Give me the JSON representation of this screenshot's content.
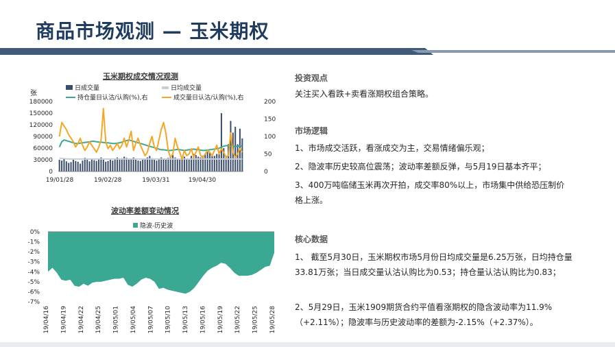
{
  "page": {
    "title": "商品市场观测 — 玉米期权"
  },
  "chart1": {
    "title": "玉米期权成交情况观测",
    "unit": "张",
    "legend": [
      "日成交量",
      "日均成交量",
      "持仓量日认沽/认购(%),右",
      "成交量日认沽/认购(%),右"
    ],
    "left_ticks": [
      "180000",
      "150000",
      "120000",
      "90000",
      "60000",
      "30000",
      "0"
    ],
    "right_ticks": [
      "200",
      "150",
      "100",
      "50",
      "0"
    ],
    "x_ticks": [
      "19/01/28",
      "19/02/28",
      "19/03/31",
      "19/04/30"
    ]
  },
  "chart2": {
    "title": "波动率差额变动情况",
    "legend": [
      "隐波-历史波"
    ],
    "y_ticks": [
      "0%",
      "-1%",
      "-2%",
      "-3%",
      "-4%",
      "-5%",
      "-6%",
      "-7%"
    ],
    "x_ticks": [
      "19/04/16",
      "19/04/19",
      "19/04/22",
      "19/04/25",
      "19/05/01",
      "19/05/04",
      "19/05/07",
      "19/05/10",
      "19/05/13",
      "19/05/16",
      "19/05/19",
      "19/05/22",
      "19/05/25",
      "19/05/28"
    ]
  },
  "chart_data": [
    {
      "type": "bar",
      "title": "玉米期权成交情况观测",
      "ylabel": "张",
      "ylim": [
        0,
        180000
      ],
      "y2lim": [
        0,
        200
      ],
      "x_range": [
        "19/01/28",
        "19/05/30"
      ],
      "series": [
        {
          "name": "日成交量",
          "axis": "left",
          "kind": "bar",
          "values": [
            30000,
            28000,
            32000,
            26000,
            22000,
            24000,
            30000,
            27000,
            25000,
            20000,
            28000,
            35000,
            30000,
            26000,
            31000,
            29000,
            27000,
            33000,
            36000,
            30000,
            25000,
            27000,
            30000,
            28000,
            32000,
            36000,
            30000,
            34000,
            38000,
            35000,
            30000,
            32000,
            36000,
            30000,
            28000,
            27000,
            30000,
            33000,
            36000,
            40000,
            34000,
            30000,
            28000,
            32000,
            36000,
            33000,
            30000,
            35000,
            38000,
            42000,
            36000,
            32000,
            30000,
            35000,
            38000,
            33000,
            30000,
            40000,
            45000,
            42000,
            38000,
            36000,
            40000,
            45000,
            50000,
            48000,
            42000,
            40000,
            45000,
            52000,
            150000,
            60000,
            40000,
            70000,
            130000,
            100000,
            115000,
            70000,
            110000,
            85000
          ]
        },
        {
          "name": "日均成交量",
          "axis": "left",
          "kind": "line",
          "values": [
            34000,
            33500,
            33000,
            32500,
            32000,
            32000,
            32000,
            32000,
            32000,
            32000,
            32000,
            32000,
            32000,
            32000,
            32000,
            32000,
            32000,
            32000,
            32000,
            32000,
            32000,
            32000,
            32000,
            32000,
            32000,
            32000,
            32000,
            32000,
            32000,
            32000,
            32000,
            32000,
            32000,
            32000,
            32000,
            32000,
            32000,
            32000,
            32000,
            32000,
            32000,
            32000,
            32000,
            32000,
            32000,
            32000,
            32000,
            32000,
            32000,
            32000,
            32000,
            32000,
            32000,
            32000,
            32000,
            32000,
            32000,
            32000,
            32000,
            32000,
            32000,
            32000,
            32000,
            32000,
            32000,
            32000,
            32000,
            32000,
            32000,
            32000,
            32000,
            32000,
            32000,
            32000,
            32000,
            32000,
            32000,
            32000,
            32000,
            32000
          ]
        },
        {
          "name": "持仓量日认沽/认购(%),右",
          "axis": "right",
          "kind": "line",
          "values": [
            70,
            85,
            90,
            88,
            86,
            84,
            82,
            80,
            80,
            81,
            82,
            83,
            84,
            85,
            86,
            86,
            85,
            84,
            84,
            83,
            82,
            82,
            81,
            80,
            80,
            81,
            82,
            84,
            86,
            88,
            90,
            88,
            86,
            84,
            82,
            80,
            78,
            76,
            74,
            72,
            70,
            68,
            66,
            64,
            62,
            62,
            61,
            60,
            60,
            61,
            62,
            63,
            62,
            61,
            60,
            61,
            62,
            63,
            64,
            63,
            62,
            61,
            60,
            60,
            61,
            62,
            63,
            64,
            65,
            66,
            70,
            72,
            74,
            73,
            72,
            72,
            71,
            72,
            73,
            72
          ]
        },
        {
          "name": "成交量日认沽/认购(%),右",
          "axis": "right",
          "kind": "line",
          "values": [
            100,
            140,
            130,
            120,
            105,
            95,
            85,
            70,
            80,
            95,
            75,
            60,
            70,
            85,
            75,
            65,
            55,
            70,
            90,
            180,
            85,
            65,
            75,
            60,
            70,
            80,
            65,
            75,
            95,
            70,
            90,
            115,
            60,
            80,
            95,
            75,
            60,
            45,
            55,
            80,
            100,
            70,
            60,
            90,
            120,
            140,
            110,
            60,
            40,
            50,
            95,
            70,
            55,
            35,
            60,
            45,
            50,
            65,
            40,
            55,
            70,
            45,
            40,
            50,
            60,
            55,
            45,
            60,
            75,
            50,
            65,
            55,
            40,
            45,
            110,
            55,
            40,
            50,
            65,
            55
          ]
        }
      ]
    },
    {
      "type": "area",
      "title": "波动率差额变动情况",
      "ylim": [
        -7,
        0
      ],
      "x_ticks": [
        "19/04/16",
        "19/04/19",
        "19/04/22",
        "19/04/25",
        "19/05/01",
        "19/05/04",
        "19/05/07",
        "19/05/10",
        "19/05/13",
        "19/05/16",
        "19/05/19",
        "19/05/22",
        "19/05/25",
        "19/05/28"
      ],
      "series": [
        {
          "name": "隐波-历史波",
          "values": [
            -4.0,
            -3.6,
            -4.1,
            -4.8,
            -4.9,
            -4.8,
            -5.4,
            -5.5,
            -5.2,
            -5.4,
            -5.1,
            -5.0,
            -5.0,
            -4.9,
            -4.8,
            -4.7,
            -4.7,
            -4.6,
            -5.3,
            -5.5,
            -5.2,
            -4.8,
            -4.6,
            -4.7,
            -5.0,
            -5.7,
            -5.6,
            -5.8,
            -5.9,
            -6.0,
            -6.1,
            -6.2,
            -6.0,
            -5.6,
            -5.0,
            -4.4,
            -3.9,
            -3.6,
            -3.4,
            -3.1,
            -3.2,
            -3.6,
            -4.1,
            -4.4,
            -4.4,
            -4.4,
            -4.3,
            -4.1,
            -3.8,
            -3.5,
            -3.4,
            -2.1
          ]
        }
      ]
    }
  ],
  "sections": [
    {
      "heading": "投资观点",
      "paragraphs": [
        "关注买入看跌+卖看涨期权组合策略。"
      ]
    },
    {
      "heading": "市场逻辑",
      "paragraphs": [
        "1、市场成交活跃，看涨成交为主，交易情绪偏乐观；",
        "2、隐波率历史较高位震荡；波动率差额反弹，与5月19日基本齐平；",
        "3、400万吨临储玉米再次开拍，成交率80%以上，市场集中供给恐压制价格上涨。"
      ]
    },
    {
      "heading": "核心数据",
      "paragraphs": [
        "1、 截至5月30日，玉米期权市场5月份日均成交量是6.25万张，日均持仓量33.81万张；当日成交量认沽认购比为0.53；持仓量认沽认购比为0.83；",
        "2、5月29日，玉米1909期货合约平值看涨期权的隐含波动率为11.9%（+2.11%）；隐波率与历史波动率的差额为-2.15%（+2.37%）。"
      ]
    }
  ],
  "colors": {
    "title": "#1f3c5e",
    "bars": "#3a4e6e",
    "avg_line": "#c9cdd6",
    "oi_line": "#3aa893",
    "vol_line": "#f5a623",
    "area": "#3aa893",
    "band": "#1f3c5e"
  }
}
